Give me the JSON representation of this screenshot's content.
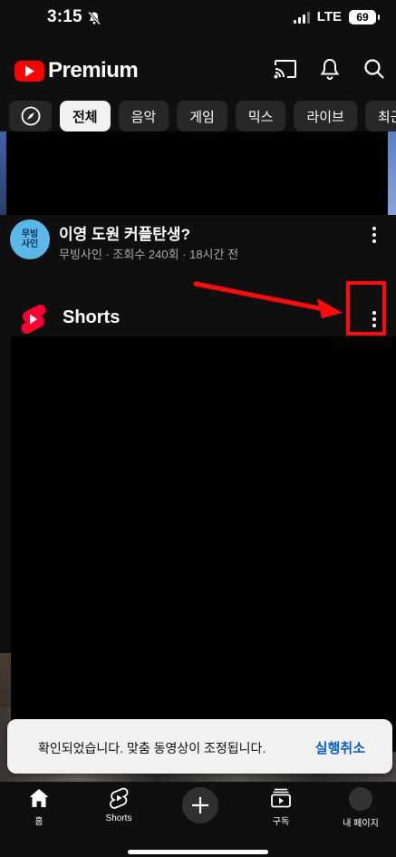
{
  "status_bar": {
    "time": "3:15",
    "network": "LTE",
    "battery": "69"
  },
  "header": {
    "brand": "Premium",
    "icons": [
      "cast-icon",
      "bell-icon",
      "search-icon"
    ]
  },
  "chips": {
    "explore_icon": "compass-icon",
    "items": [
      "전체",
      "음악",
      "게임",
      "믹스",
      "라이브",
      "최근"
    ],
    "selected": "전체"
  },
  "video": {
    "title": "이영 도원 커플탄생?",
    "meta": "무빙사인 · 조회수 240회 · 18시간 전",
    "channel_avatar_text": [
      "무빙",
      "사인"
    ]
  },
  "shorts": {
    "title": "Shorts"
  },
  "toast": {
    "message": "확인되었습니다. 맞춤 동영상이 조정됩니다.",
    "action": "실행취소"
  },
  "bottom_nav": {
    "items": [
      {
        "label": "홈",
        "icon": "home-icon"
      },
      {
        "label": "Shorts",
        "icon": "shorts-icon"
      },
      {
        "label": "",
        "icon": "plus-icon"
      },
      {
        "label": "구독",
        "icon": "subscriptions-icon"
      },
      {
        "label": "내 페이지",
        "icon": "avatar-icon"
      }
    ]
  },
  "colors": {
    "accent": "#ff0000",
    "link": "#065fd4",
    "background": "#0f0f0f"
  }
}
